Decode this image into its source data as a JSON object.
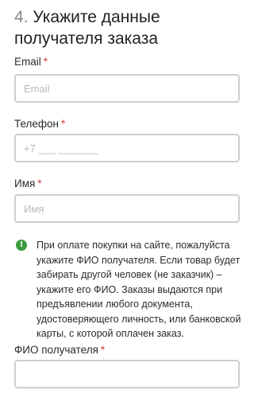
{
  "section": {
    "number": "4.",
    "title": "Укажите данные получателя заказа"
  },
  "fields": {
    "email": {
      "label": "Email",
      "required_mark": "*",
      "placeholder": "Email",
      "value": ""
    },
    "phone": {
      "label": "Телефон",
      "required_mark": "*",
      "placeholder": "+7 ___ _______",
      "value": ""
    },
    "name": {
      "label": "Имя",
      "required_mark": "*",
      "placeholder": "Имя",
      "value": ""
    },
    "recipient_full_name": {
      "label": "ФИО получателя",
      "required_mark": "*",
      "placeholder": "",
      "value": ""
    }
  },
  "notice": {
    "icon": "info-icon",
    "icon_glyph": "!",
    "text": "При оплате покупки на сайте, пожалуйста укажите ФИО получателя. Если товар будет забирать другой человек (не заказчик) – укажите его ФИО. Заказы выдаются при предъявлении любого документа, удостоверяющего личность, или банковской карты, с которой оплачен заказ."
  },
  "colors": {
    "required": "#d6383a",
    "info_icon": "#3a9a3f",
    "input_border": "#cfcfcf"
  }
}
